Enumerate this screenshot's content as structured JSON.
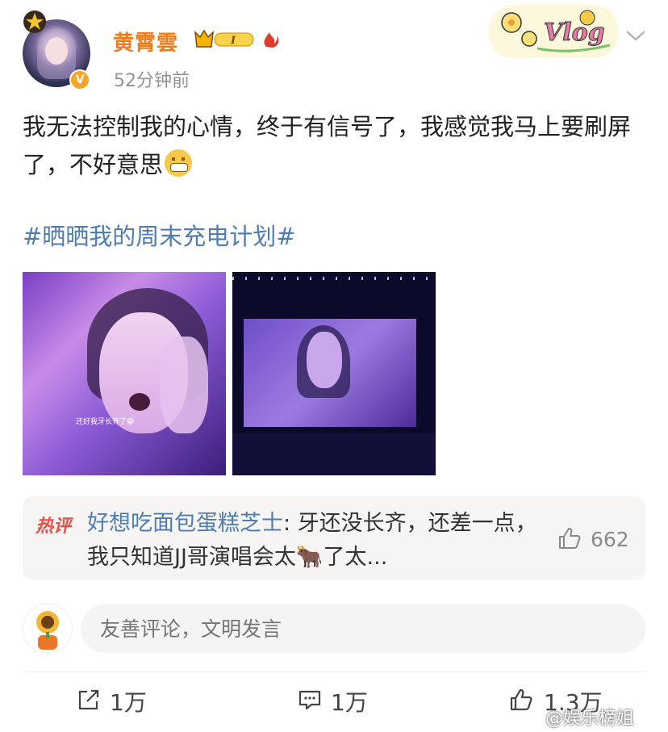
{
  "post": {
    "username": "黄霄雲",
    "vip_level": "I",
    "time": "52分钟前",
    "text": "我无法控制我的心情，终于有信号了，我感觉我马上要刷屏了，不好意思",
    "topic": "#晒晒我的周末充电计划#",
    "photo_caption": "还好我牙长齐了😁"
  },
  "hot_comment": {
    "label": "热评",
    "user": "好想吃面包蛋糕芝士",
    "text": ": 牙还没长齐，还差一点，我只知道JJ哥演唱会太🐂了太...",
    "likes": "662"
  },
  "comment_input": {
    "placeholder": "友善评论，文明发言"
  },
  "actions": {
    "repost": "1万",
    "comment": "1万",
    "like": "1.3万"
  },
  "watermark": "@娱乐榜姐",
  "colors": {
    "username": "#f17c1b",
    "topic": "#4f7db1",
    "hot_label": "#e8504a",
    "verified": "#f6a623"
  }
}
